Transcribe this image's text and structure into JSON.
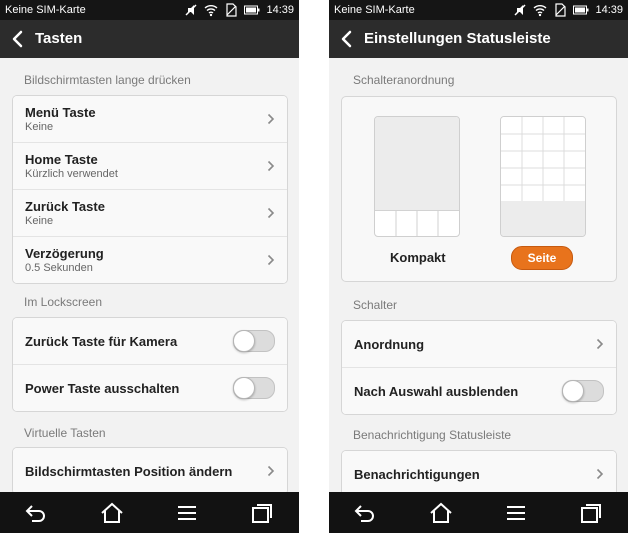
{
  "left": {
    "status": {
      "carrier": "Keine SIM-Karte",
      "time": "14:39"
    },
    "title": "Tasten",
    "sections": {
      "long_press": "Bildschirmtasten lange drücken",
      "lockscreen": "Im Lockscreen",
      "virtual": "Virtuelle Tasten"
    },
    "rows": {
      "menu": {
        "label": "Menü Taste",
        "value": "Keine"
      },
      "home": {
        "label": "Home Taste",
        "value": "Kürzlich verwendet"
      },
      "back": {
        "label": "Zurück Taste",
        "value": "Keine"
      },
      "delay": {
        "label": "Verzögerung",
        "value": "0.5 Sekunden"
      },
      "back_camera": {
        "label": "Zurück Taste für Kamera"
      },
      "power_off": {
        "label": "Power Taste ausschalten"
      },
      "position": {
        "label": "Bildschirmtasten Position ändern"
      }
    }
  },
  "right": {
    "status": {
      "carrier": "Keine SIM-Karte",
      "time": "14:39"
    },
    "title": "Einstellungen Statusleiste",
    "sections": {
      "switch_layout": "Schalteranordnung",
      "switches": "Schalter",
      "notifications": "Benachrichtigung Statusleiste"
    },
    "layout_options": {
      "compact": "Kompakt",
      "page": "Seite"
    },
    "rows": {
      "order": {
        "label": "Anordnung"
      },
      "hide_after": {
        "label": "Nach Auswahl ausblenden"
      },
      "notifications": {
        "label": "Benachrichtigungen"
      }
    }
  },
  "colors": {
    "accent": "#e8731c",
    "titlebar": "#2c2c2c",
    "statusbar": "#151515",
    "navbar": "#121212"
  }
}
